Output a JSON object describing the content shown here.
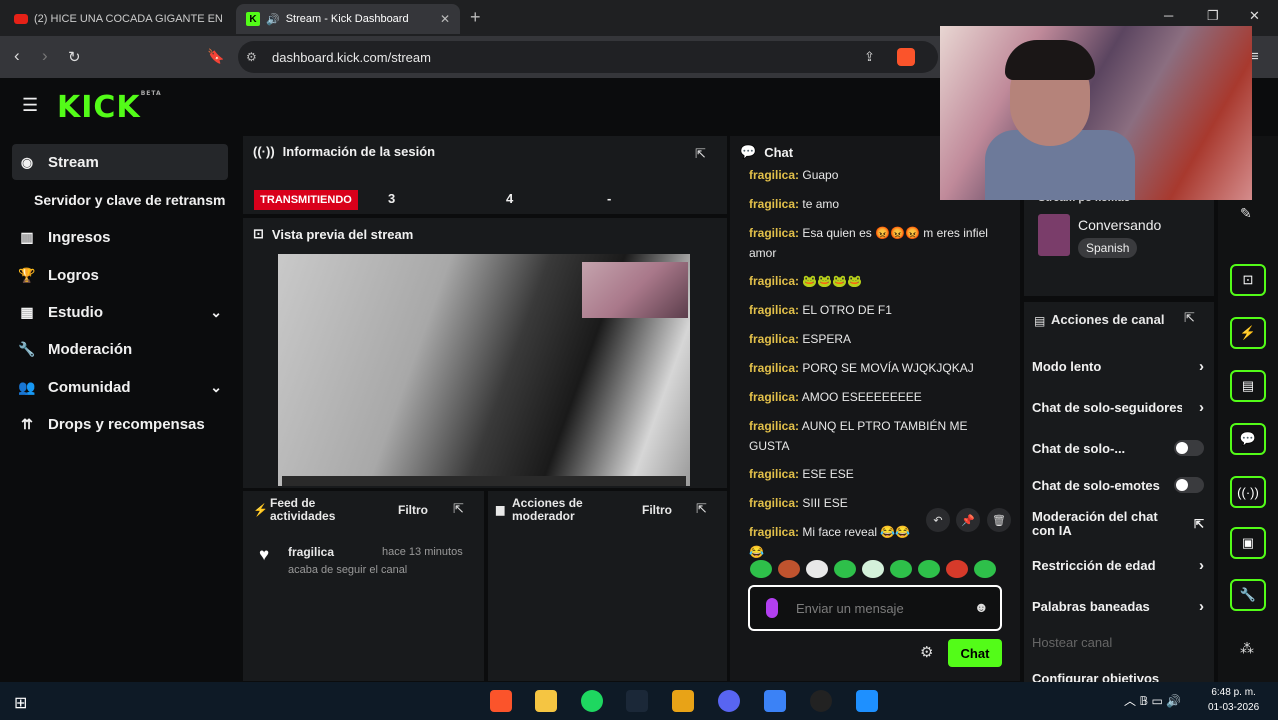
{
  "browser": {
    "tabs": [
      {
        "label": "(2) HICE UNA COCADA GIGANTE EN"
      },
      {
        "label": "Stream - Kick Dashboard"
      }
    ],
    "url": "dashboard.kick.com/stream"
  },
  "brand": {
    "logo": "KICK",
    "beta": "BETA",
    "accent": "#53fc18"
  },
  "sidebar": {
    "items": [
      {
        "label": "Stream",
        "icon": "stream-icon"
      },
      {
        "label": "Servidor y clave de retransm"
      },
      {
        "label": "Ingresos",
        "icon": "chart-icon"
      },
      {
        "label": "Logros",
        "icon": "trophy-icon"
      },
      {
        "label": "Estudio",
        "icon": "studio-icon"
      },
      {
        "label": "Moderación",
        "icon": "wrench-icon"
      },
      {
        "label": "Comunidad",
        "icon": "community-icon"
      },
      {
        "label": "Drops y recompensas",
        "icon": "drops-icon"
      }
    ]
  },
  "session": {
    "title": "Información de la sesión",
    "status": "TRANSMITIENDO",
    "stats": [
      "3",
      "4",
      "-"
    ]
  },
  "preview": {
    "title": "Vista previa del stream"
  },
  "feed": {
    "title": "Feed de actividades",
    "filter": "Filtro",
    "items": [
      {
        "user": "fragilica",
        "time": "hace 13 minutos",
        "text": "acaba de seguir el canal"
      }
    ]
  },
  "mod_actions": {
    "title": "Acciones de moderador",
    "filter": "Filtro"
  },
  "chat": {
    "title": "Chat",
    "messages": [
      {
        "user": "fragilica:",
        "text": "Guapo"
      },
      {
        "user": "fragilica:",
        "text": "te amo"
      },
      {
        "user": "fragilica:",
        "text": "Esa quien es 😡😡😡 m eres infiel amor"
      },
      {
        "user": "fragilica:",
        "text": "🐸🐸🐸🐸"
      },
      {
        "user": "fragilica:",
        "text": "EL OTRO DE F1"
      },
      {
        "user": "fragilica:",
        "text": "ESPERA"
      },
      {
        "user": "fragilica:",
        "text": "PORQ SE MOVÍA WJQKJQKAJ"
      },
      {
        "user": "fragilica:",
        "text": "AMOO ESEEEEEEEE"
      },
      {
        "user": "fragilica:",
        "text": "AUNQ EL PTRO TAMBIÉN ME GUSTA"
      },
      {
        "user": "fragilica:",
        "text": "ESE ESE"
      },
      {
        "user": "fragilica:",
        "text": "SIII ESE"
      },
      {
        "user": "fragilica:",
        "text": "Mi face reveal 😂😂😂"
      }
    ],
    "placeholder": "Enviar un mensaje",
    "send_label": "Chat"
  },
  "stream_info": {
    "category": "Conversando",
    "language": "Spanish",
    "partial_title": "Stream po komao"
  },
  "channel_actions": {
    "title": "Acciones de canal",
    "items": [
      {
        "label": "Modo lento",
        "kind": "chevron"
      },
      {
        "label": "Chat de solo-seguidores",
        "kind": "chevron"
      },
      {
        "label": "Chat de solo-...",
        "kind": "toggle"
      },
      {
        "label": "Chat de solo-emotes",
        "kind": "toggle"
      },
      {
        "label": "Moderación del chat con IA",
        "kind": "external"
      },
      {
        "label": "Restricción de edad",
        "kind": "chevron"
      },
      {
        "label": "Palabras baneadas",
        "kind": "chevron"
      },
      {
        "label": "Hostear canal",
        "kind": "disabled"
      },
      {
        "label": "Configurar objetivos",
        "kind": "chevron"
      }
    ]
  },
  "taskbar": {
    "time": "6:48 p. m.",
    "date": "01-03-2026"
  }
}
